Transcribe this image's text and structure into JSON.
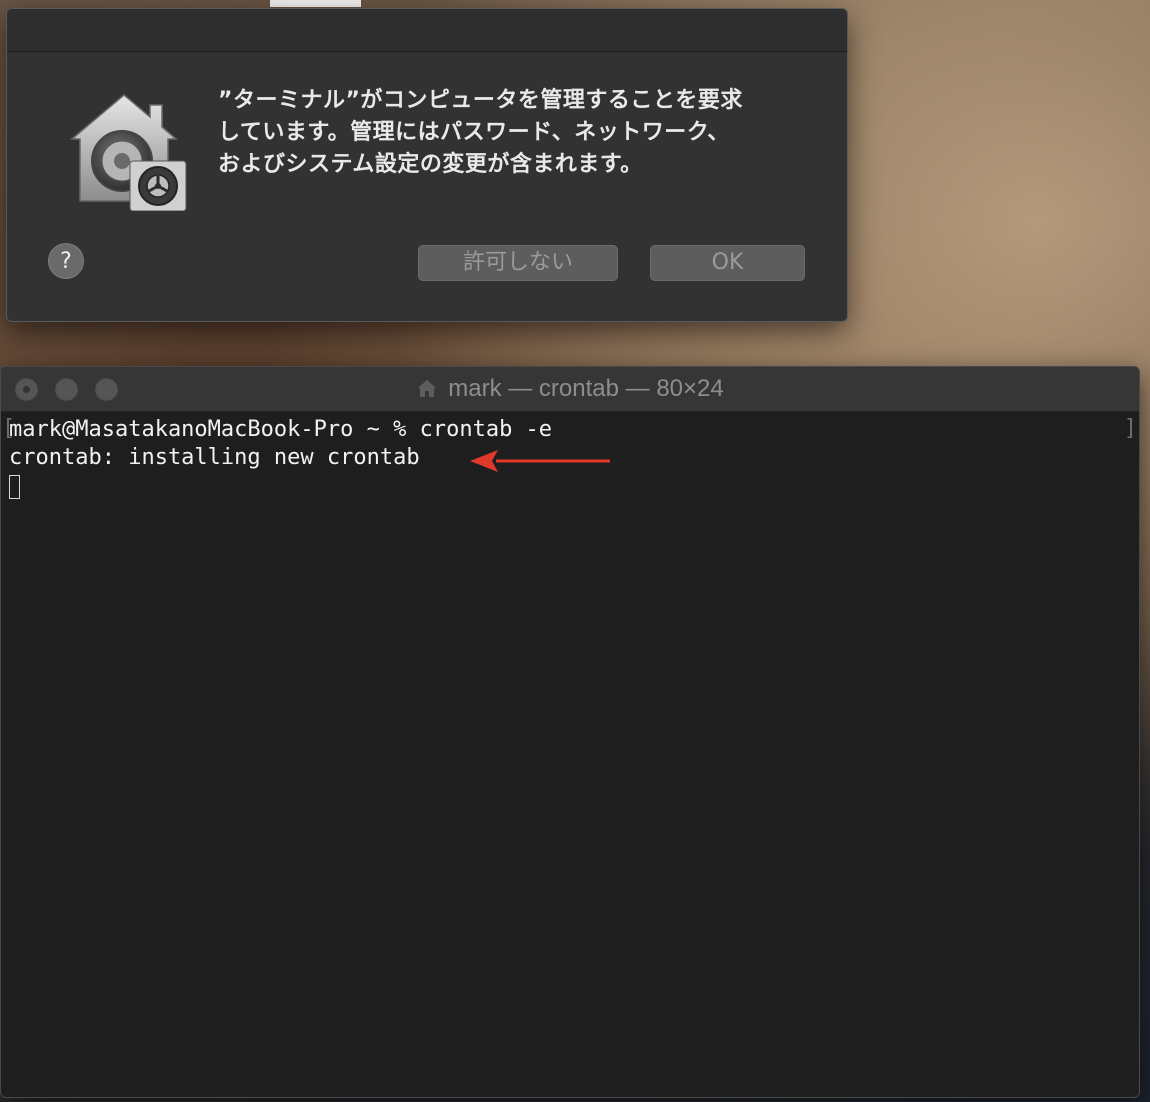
{
  "dialog": {
    "message": "”ターミナル”がコンピュータを管理することを要求\nしています。管理にはパスワード、ネットワーク、\nおよびシステム設定の変更が含まれます。",
    "help_label": "?",
    "deny_label": "許可しない",
    "ok_label": "OK",
    "icon": "lock-house-gear-icon"
  },
  "terminal": {
    "title": "mark — crontab — 80×24",
    "title_icon": "home-icon",
    "lines": [
      "mark@MasatakanoMacBook-Pro ~ % crontab -e",
      "crontab: installing new crontab"
    ],
    "annotation_color": "#e0392b"
  }
}
